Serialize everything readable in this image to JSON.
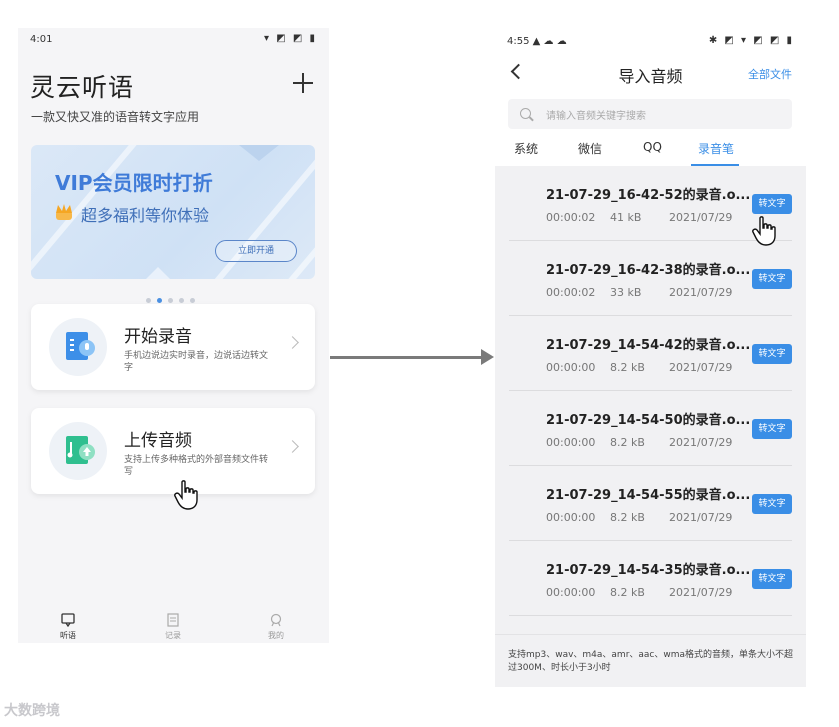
{
  "left_phone": {
    "status_time": "4:01",
    "status_icons": "▾ ◩ ◩ ▮",
    "app_title": "灵云听语",
    "app_subtitle": "一款又快又准的语音转文字应用",
    "banner": {
      "title": "VIP会员限时打折",
      "subtitle": "超多福利等你体验",
      "button": "立即开通"
    },
    "cards": [
      {
        "title": "开始录音",
        "desc": "手机边说边实时录音，边说话边转文字"
      },
      {
        "title": "上传音频",
        "desc": "支持上传多种格式的外部音频文件转写"
      }
    ],
    "tabbar": [
      {
        "label": "听语",
        "icon": "chat-icon"
      },
      {
        "label": "记录",
        "icon": "document-icon"
      },
      {
        "label": "我的",
        "icon": "user-icon"
      }
    ]
  },
  "right_phone": {
    "status_time": "4:55",
    "status_icons_left": "▲ ☁ ☁",
    "status_icons_right": "✱ ◩ ▾ ◩ ◩ ▮",
    "nav_title": "导入音频",
    "nav_link": "全部文件",
    "search_placeholder": "请输入音频关键字搜索",
    "tabs": [
      "系统",
      "微信",
      "QQ",
      "录音笔"
    ],
    "active_tab": "录音笔",
    "files": [
      {
        "name": "21-07-29_16-42-52的录音.o...",
        "duration": "00:00:02",
        "size": "41 kB",
        "date": "2021/07/29",
        "button": "转文字"
      },
      {
        "name": "21-07-29_16-42-38的录音.o...",
        "duration": "00:00:02",
        "size": "33 kB",
        "date": "2021/07/29",
        "button": "转文字"
      },
      {
        "name": "21-07-29_14-54-42的录音.o...",
        "duration": "00:00:00",
        "size": "8.2 kB",
        "date": "2021/07/29",
        "button": "转文字"
      },
      {
        "name": "21-07-29_14-54-50的录音.o...",
        "duration": "00:00:00",
        "size": "8.2 kB",
        "date": "2021/07/29",
        "button": "转文字"
      },
      {
        "name": "21-07-29_14-54-55的录音.o...",
        "duration": "00:00:00",
        "size": "8.2 kB",
        "date": "2021/07/29",
        "button": "转文字"
      },
      {
        "name": "21-07-29_14-54-35的录音.o...",
        "duration": "00:00:00",
        "size": "8.2 kB",
        "date": "2021/07/29",
        "button": "转文字"
      }
    ],
    "footer_text": "支持mp3、wav、m4a、amr、aac、wma格式的音频，单条大小不超过300M、时长小于3小时"
  },
  "watermark": "大数跨境",
  "colors": {
    "accent": "#3a8ee6",
    "banner_title": "#3f7bd8",
    "arrow": "#7a7a7a"
  }
}
